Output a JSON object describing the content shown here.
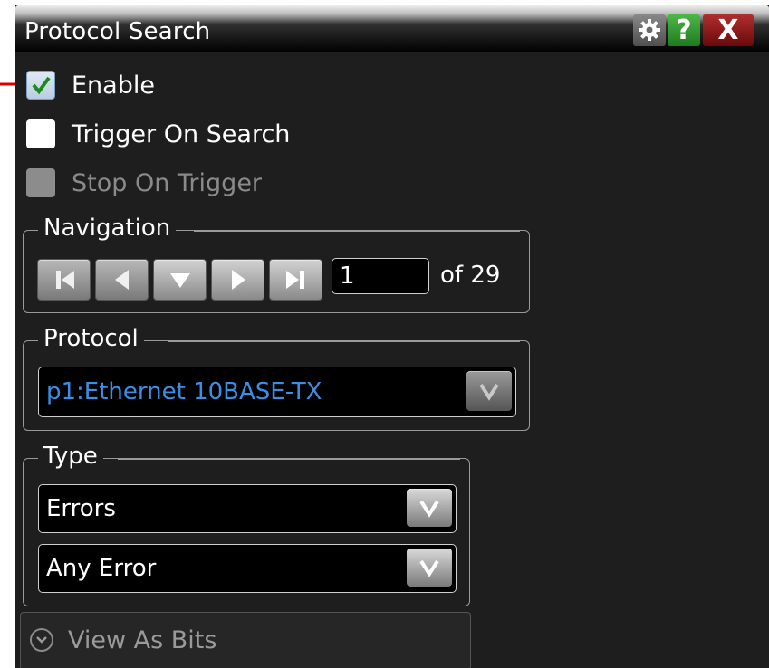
{
  "window": {
    "title": "Protocol Search",
    "icons": [
      "gear-icon",
      "help-icon",
      "close-icon"
    ],
    "help_glyph": "?",
    "close_glyph": "X"
  },
  "options": {
    "enable": {
      "label": "Enable",
      "checked": true
    },
    "trigger_on_search": {
      "label": "Trigger On Search",
      "checked": false
    },
    "stop_on_trigger": {
      "label": "Stop On Trigger",
      "checked": false,
      "disabled": true
    }
  },
  "navigation": {
    "label": "Navigation",
    "buttons": [
      "first-icon",
      "previous-icon",
      "down-icon",
      "next-icon",
      "last-icon"
    ],
    "current": "1",
    "of_text": "of 29"
  },
  "protocol": {
    "label": "Protocol",
    "selected": "p1:Ethernet 10BASE-TX"
  },
  "type": {
    "label": "Type",
    "primary": "Errors",
    "secondary": "Any Error"
  },
  "view_as_bits": {
    "label": "View As Bits"
  },
  "colors": {
    "panel_bg": "#1e1e1e",
    "protocol_text": "#3a8ee6",
    "annotation_arrow": "#e00000",
    "checkmark": "#1a8a1a"
  }
}
